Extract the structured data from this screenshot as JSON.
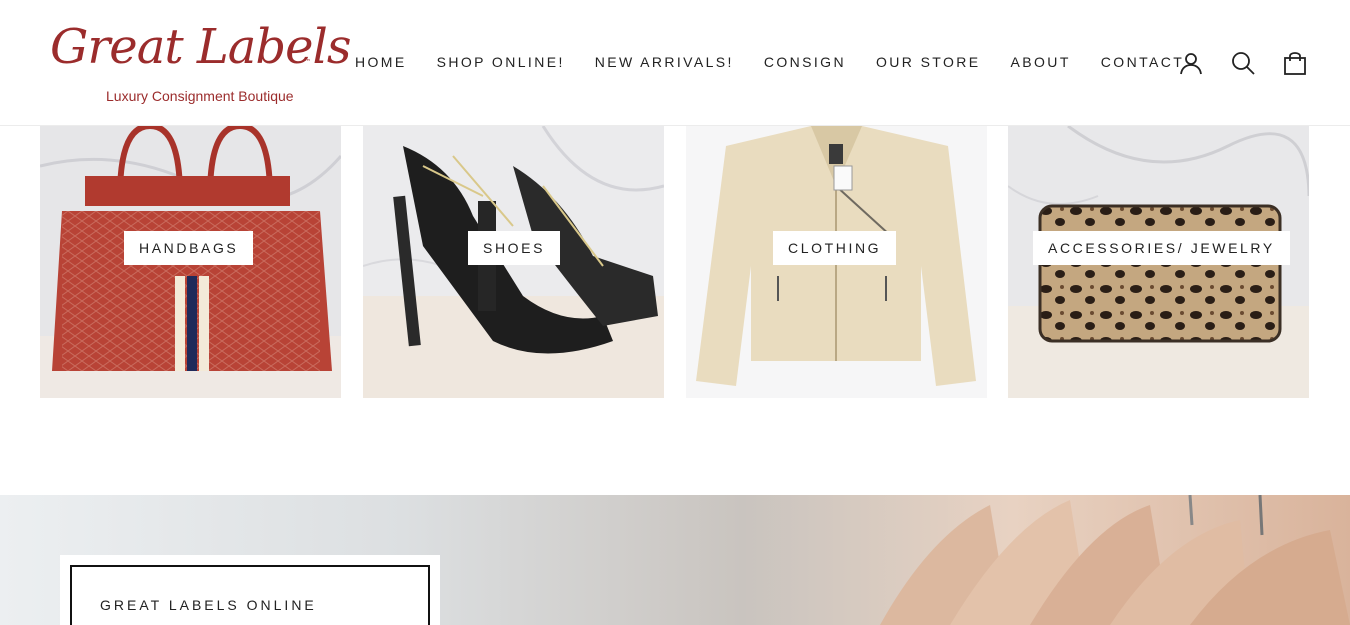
{
  "brand": {
    "name": "Great Labels",
    "tagline": "Luxury Consignment Boutique",
    "trademark": "™",
    "color": "#9b2c2c"
  },
  "nav": {
    "items": [
      "HOME",
      "SHOP ONLINE!",
      "NEW ARRIVALS!",
      "CONSIGN",
      "OUR STORE",
      "ABOUT",
      "CONTACT"
    ]
  },
  "header_icons": [
    "user-icon",
    "search-icon",
    "cart-icon"
  ],
  "categories": [
    {
      "label": "HANDBAGS",
      "image": "red handbag with ND monogram"
    },
    {
      "label": "SHOES",
      "image": "black platform sandals"
    },
    {
      "label": "CLOTHING",
      "image": "beige leather jacket"
    },
    {
      "label": "ACCESSORIES/ JEWELRY",
      "image": "leopard print wallet"
    }
  ],
  "hero": {
    "title": "GREAT LABELS ONLINE"
  }
}
